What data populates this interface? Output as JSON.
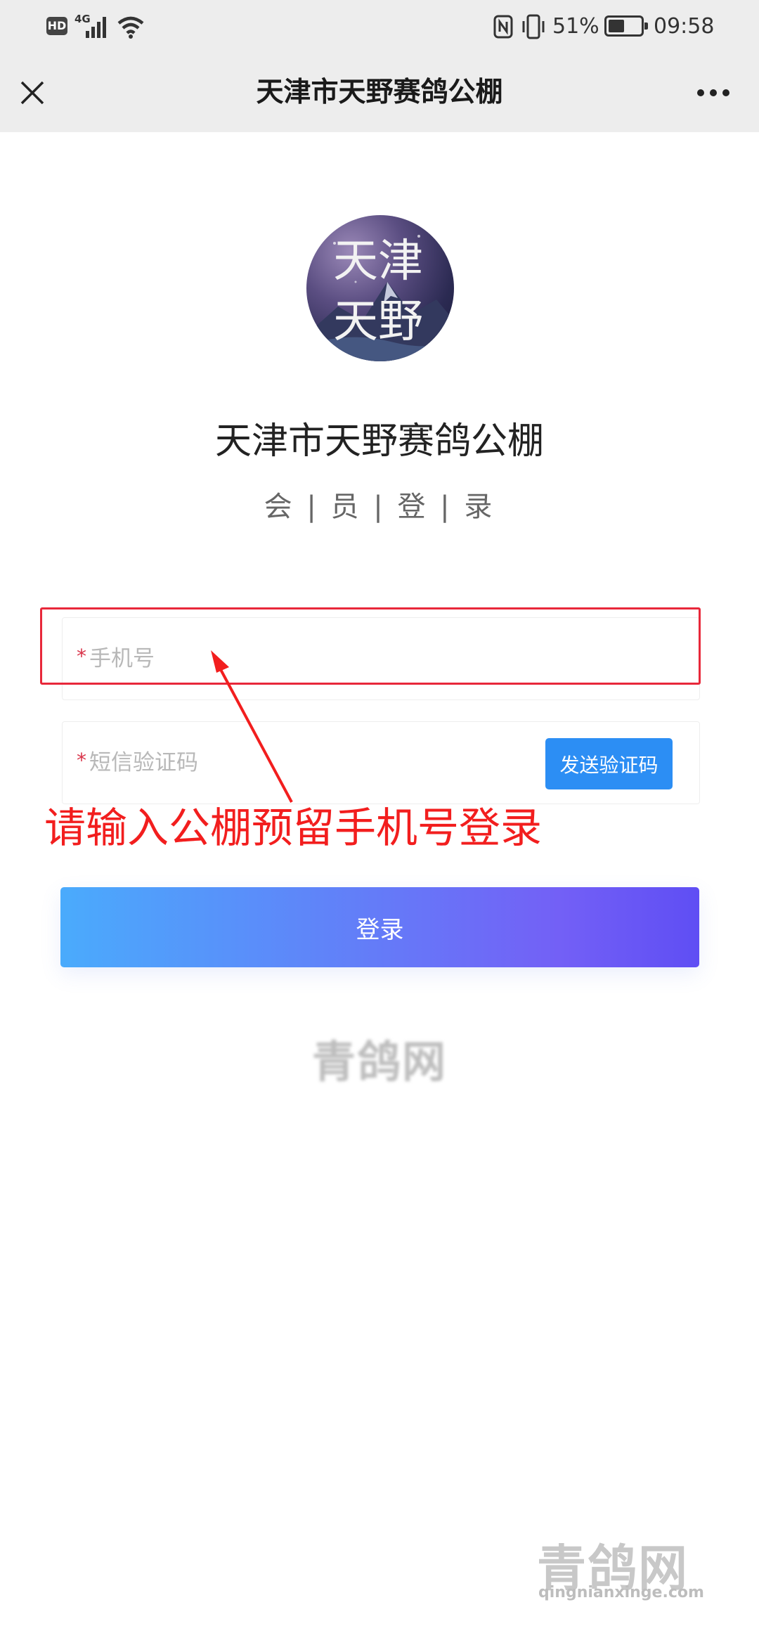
{
  "status_bar": {
    "hd": "HD",
    "network": "4G",
    "battery_percent": "51%",
    "time": "09:58",
    "battery_level": 0.51
  },
  "nav": {
    "title": "天津市天野赛鸽公棚",
    "close_icon": "close-icon",
    "more_icon": "more-icon"
  },
  "logo": {
    "line1": "天津",
    "line2": "天野"
  },
  "brand": {
    "title": "天津市天野赛鸽公棚",
    "subtitle": "会 | 员 | 登 | 录"
  },
  "form": {
    "required_mark": "*",
    "phone_placeholder": "手机号",
    "code_placeholder": "短信验证码",
    "send_code_label": "发送验证码",
    "login_label": "登录"
  },
  "annotation": {
    "text": "请输入公棚预留手机号登录",
    "color": "#f21e1e"
  },
  "watermarks": {
    "center": "青鸽网",
    "corner": "青鸽网",
    "url": "qingnianxinge.com"
  },
  "colors": {
    "accent": "#2c8ef4",
    "gradient_start": "#4aabfc",
    "gradient_end": "#5f4ef4",
    "required": "#d9344a"
  }
}
